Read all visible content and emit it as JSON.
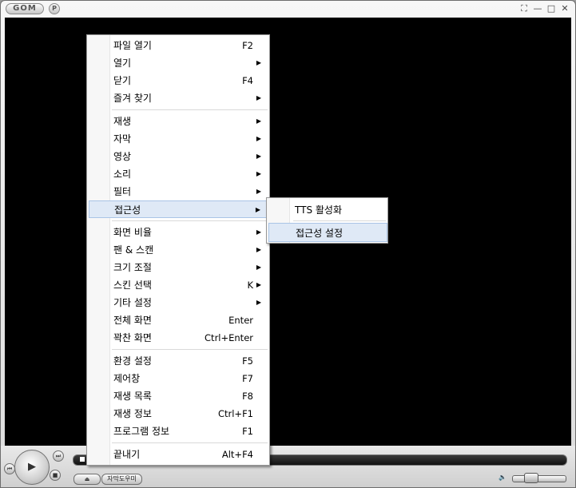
{
  "titlebar": {
    "logo_text": "GOM",
    "p_button": "P",
    "buttons": {
      "fullscreen": "⛶",
      "minimize": "—",
      "maximize": "□",
      "close": "✕"
    }
  },
  "controls": {
    "subtitle_button": "자막도우미",
    "play_icon": "play-icon",
    "seek_progress": 0.0
  },
  "context_menu": {
    "groups": [
      [
        {
          "label": "파일 열기",
          "accel": "F2",
          "submenu": false
        },
        {
          "label": "열기",
          "accel": "",
          "submenu": true
        },
        {
          "label": "닫기",
          "accel": "F4",
          "submenu": false
        },
        {
          "label": "즐겨 찾기",
          "accel": "",
          "submenu": true
        }
      ],
      [
        {
          "label": "재생",
          "accel": "",
          "submenu": true
        },
        {
          "label": "자막",
          "accel": "",
          "submenu": true
        },
        {
          "label": "영상",
          "accel": "",
          "submenu": true
        },
        {
          "label": "소리",
          "accel": "",
          "submenu": true
        },
        {
          "label": "필터",
          "accel": "",
          "submenu": true
        },
        {
          "label": "접근성",
          "accel": "",
          "submenu": true,
          "highlighted": true
        }
      ],
      [
        {
          "label": "화면 비율",
          "accel": "",
          "submenu": true
        },
        {
          "label": "팬 & 스캔",
          "accel": "",
          "submenu": true
        },
        {
          "label": "크기 조절",
          "accel": "",
          "submenu": true
        },
        {
          "label": "스킨 선택",
          "accel": "K",
          "submenu": true
        },
        {
          "label": "기타 설정",
          "accel": "",
          "submenu": true
        },
        {
          "label": "전체 화면",
          "accel": "Enter",
          "submenu": false
        },
        {
          "label": "꽉찬 화면",
          "accel": "Ctrl+Enter",
          "submenu": false
        }
      ],
      [
        {
          "label": "환경 설정",
          "accel": "F5",
          "submenu": false
        },
        {
          "label": "제어창",
          "accel": "F7",
          "submenu": false
        },
        {
          "label": "재생 목록",
          "accel": "F8",
          "submenu": false
        },
        {
          "label": "재생 정보",
          "accel": "Ctrl+F1",
          "submenu": false
        },
        {
          "label": "프로그램 정보",
          "accel": "F1",
          "submenu": false
        }
      ],
      [
        {
          "label": "끝내기",
          "accel": "Alt+F4",
          "submenu": false
        }
      ]
    ]
  },
  "accessibility_submenu": {
    "items": [
      {
        "label": "TTS 활성화",
        "highlighted": false
      },
      {
        "label": "접근성 설정",
        "highlighted": true
      }
    ]
  },
  "colors": {
    "highlight_bg": "#dfe9f6",
    "highlight_border": "#a9c4e6",
    "video_bg": "#000000"
  }
}
